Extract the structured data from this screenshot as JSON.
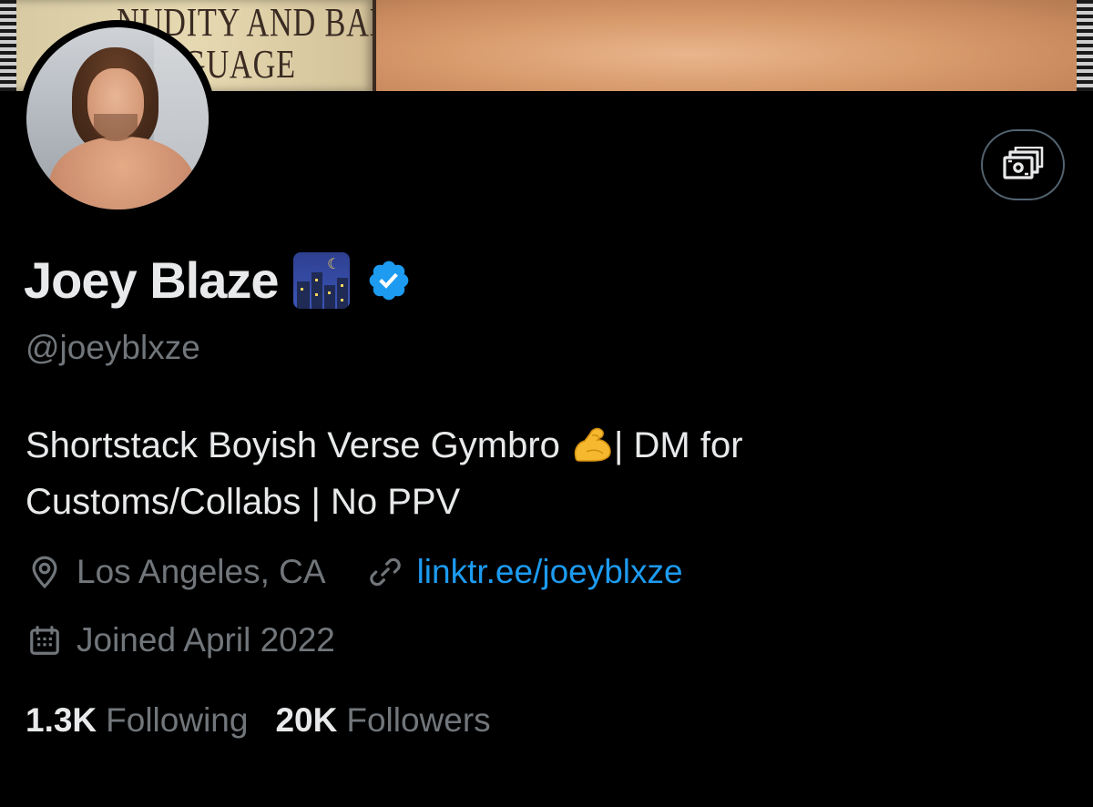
{
  "banner": {
    "poster_text_line1": "NUDITY AND BAD",
    "poster_text_line2": "LANGUAGE"
  },
  "profile": {
    "display_name": "Joey Blaze",
    "handle": "@joeyblxze",
    "bio_part1": "Shortstack Boyish Verse Gymbro ",
    "bio_part2": "| DM for",
    "bio_part3": "Customs/Collabs | No PPV",
    "location": "Los Angeles, CA",
    "link": "linktr.ee/joeyblxze",
    "joined": "Joined April 2022",
    "following_count": "1.3K",
    "following_label": "Following",
    "followers_count": "20K",
    "followers_label": "Followers"
  },
  "icons": {
    "verified": "verified-badge-icon",
    "location": "location-pin-icon",
    "link": "link-icon",
    "calendar": "calendar-icon",
    "money": "money-tip-icon"
  },
  "colors": {
    "background": "#000000",
    "text_primary": "#e7e9ea",
    "text_secondary": "#71767b",
    "link": "#1d9bf0",
    "verified": "#1d9bf0",
    "button_border": "#536471"
  }
}
